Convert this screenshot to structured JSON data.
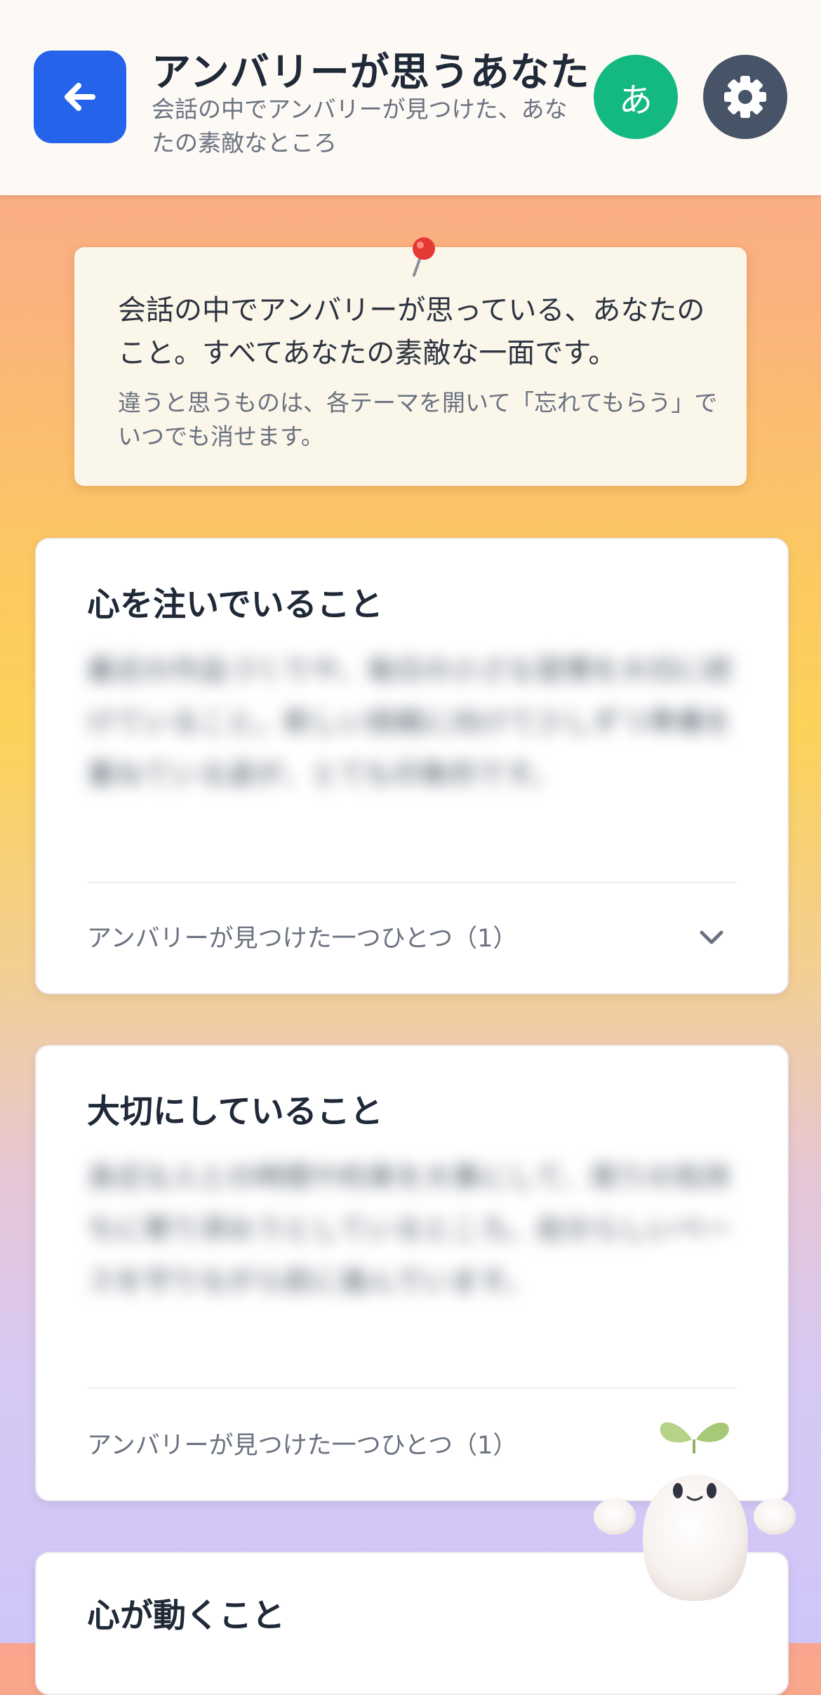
{
  "header": {
    "title": "アンバリーが思うあなた",
    "subtitle": "会話の中でアンバリーが見つけた、あなたの素敵なところ",
    "lang_label": "あ"
  },
  "note": {
    "main": "会話の中でアンバリーが思っている、あなたのこと。すべてあなたの素敵な一面です。",
    "sub": "違うと思うものは、各テーマを開いて「忘れてもらう」でいつでも消せます。"
  },
  "cards": [
    {
      "title": "心を注いでいること",
      "blurred_text": "最近の作品づくりや、毎日の小さな習慣を大切に続けていること。新しい挑戦に向けて少しずつ準備を重ねている姿が、とても印象的です。",
      "footer": "アンバリーが見つけた一つひとつ（1）"
    },
    {
      "title": "大切にしていること",
      "blurred_text": "身近な人との時間や約束を大事にして、周りの気持ちに寄り添おうとしているところ。自分らしいペースを守りながら前に進んでいます。",
      "footer": "アンバリーが見つけた一つひとつ（1）"
    },
    {
      "title": "心が動くこと"
    }
  ],
  "colors": {
    "accent_blue": "#2563eb",
    "lang_green": "#13b981",
    "settings_gray": "#475366"
  },
  "icons": {
    "back": "arrow-left-icon",
    "settings": "gear-icon",
    "pin": "pushpin-icon",
    "expand": "chevron-down-icon",
    "mascot": "sprout-mascot"
  }
}
